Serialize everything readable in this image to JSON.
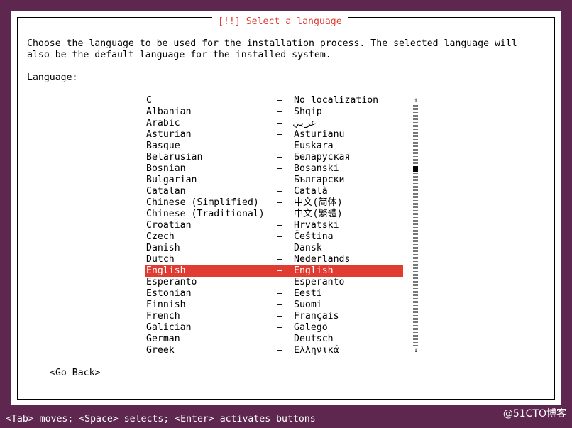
{
  "dialog": {
    "title": "[!!] Select a language",
    "intro_line_1": "Choose the language to be used for the installation process. The selected language will",
    "intro_line_2": "also be the default language for the installed system.",
    "language_label": "Language:"
  },
  "languages": [
    {
      "name": "C",
      "native": "No localization"
    },
    {
      "name": "Albanian",
      "native": "Shqip"
    },
    {
      "name": "Arabic",
      "native": "عربي"
    },
    {
      "name": "Asturian",
      "native": "Asturianu"
    },
    {
      "name": "Basque",
      "native": "Euskara"
    },
    {
      "name": "Belarusian",
      "native": "Беларуская"
    },
    {
      "name": "Bosnian",
      "native": "Bosanski"
    },
    {
      "name": "Bulgarian",
      "native": "Български"
    },
    {
      "name": "Catalan",
      "native": "Català"
    },
    {
      "name": "Chinese (Simplified)",
      "native": "中文(简体)"
    },
    {
      "name": "Chinese (Traditional)",
      "native": "中文(繁體)"
    },
    {
      "name": "Croatian",
      "native": "Hrvatski"
    },
    {
      "name": "Czech",
      "native": "Čeština"
    },
    {
      "name": "Danish",
      "native": "Dansk"
    },
    {
      "name": "Dutch",
      "native": "Nederlands"
    },
    {
      "name": "English",
      "native": "English"
    },
    {
      "name": "Esperanto",
      "native": "Esperanto"
    },
    {
      "name": "Estonian",
      "native": "Eesti"
    },
    {
      "name": "Finnish",
      "native": "Suomi"
    },
    {
      "name": "French",
      "native": "Français"
    },
    {
      "name": "Galician",
      "native": "Galego"
    },
    {
      "name": "German",
      "native": "Deutsch"
    },
    {
      "name": "Greek",
      "native": "Ελληνικά"
    }
  ],
  "separator": "–",
  "selected_language": "English",
  "scrollbar": {
    "up_icon": "arrow-up-icon",
    "down_icon": "arrow-down-icon",
    "position": 0.26
  },
  "buttons": {
    "go_back": "<Go Back>"
  },
  "status_bar": "<Tab> moves; <Space> selects; <Enter> activates buttons",
  "watermark": "@51CTO博客",
  "colors": {
    "background": "#5e2750",
    "dialog": "#ffffff",
    "accent": "#e03c31",
    "text": "#000000",
    "status_text": "#ffffff"
  }
}
